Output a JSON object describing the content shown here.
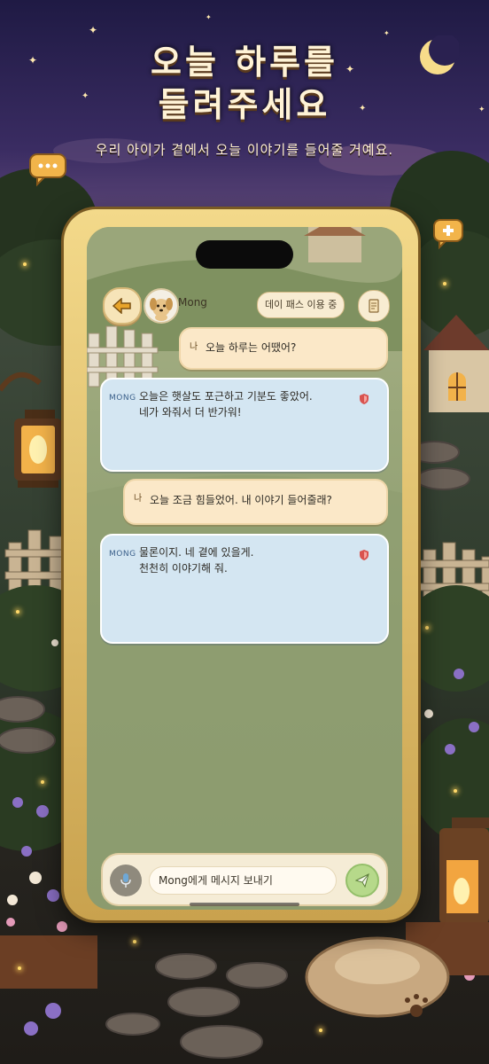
{
  "header": {
    "title_line1": "오늘 하루를",
    "title_line2": "들려주세요",
    "subtitle": "우리 아이가 곁에서 오늘 이야기를 들어줄 거예요."
  },
  "chat_header": {
    "pet_name": "Mong",
    "day_pass_label": "데이 패스 이용 중"
  },
  "messages": [
    {
      "sender": "user",
      "tag": "나",
      "text": "오늘 하루는 어땠어?"
    },
    {
      "sender": "pet",
      "tag": "MONG",
      "text": "오늘은 햇살도 포근하고 기분도 좋았어.\n네가 와줘서 더 반가워!"
    },
    {
      "sender": "user",
      "tag": "나",
      "text": "오늘 조금 힘들었어. 내 이야기 들어줄래?"
    },
    {
      "sender": "pet",
      "tag": "MONG",
      "text": "물론이지. 네 곁에 있을게.\n천천히 이야기해 줘."
    }
  ],
  "composer": {
    "placeholder": "Mong에게 메시지 보내기",
    "value": ""
  },
  "icons": {
    "back": "arrow-left-icon",
    "diary": "scroll-icon",
    "mic": "mic-icon",
    "send": "paper-plane-icon",
    "safety": "shield-icon",
    "moon": "crescent-moon-icon",
    "chat_bubble": "chat-bubble-icon"
  },
  "colors": {
    "user_bubble": "#fbe8c8",
    "pet_bubble": "#d4e6f2",
    "frame_gold": "#e8c878",
    "send_green": "#b6d98a",
    "safety_red": "#d9534f"
  }
}
